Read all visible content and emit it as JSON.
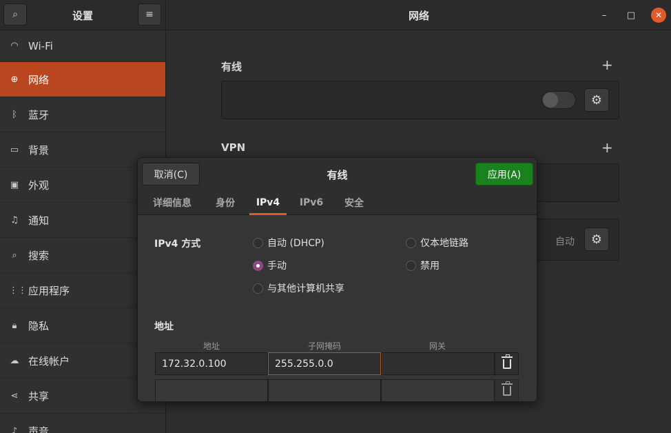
{
  "sidebar": {
    "title": "设置",
    "search_icon": "search-icon",
    "menu_icon": "menu-icon",
    "items": [
      {
        "label": "Wi-Fi",
        "icon": "wifi-icon",
        "glyph": "◠"
      },
      {
        "label": "网络",
        "icon": "network-icon",
        "glyph": "⊕"
      },
      {
        "label": "蓝牙",
        "icon": "bluetooth-icon",
        "glyph": "ᛒ"
      },
      {
        "label": "背景",
        "icon": "background-icon",
        "glyph": "▭"
      },
      {
        "label": "外观",
        "icon": "appearance-icon",
        "glyph": "▣"
      },
      {
        "label": "通知",
        "icon": "bell-icon",
        "glyph": "♫"
      },
      {
        "label": "搜索",
        "icon": "search-icon",
        "glyph": "⌕"
      },
      {
        "label": "应用程序",
        "icon": "apps-grid-icon",
        "glyph": "⋮⋮"
      },
      {
        "label": "隐私",
        "icon": "lock-icon",
        "glyph": "🔒"
      },
      {
        "label": "在线帐户",
        "icon": "cloud-icon",
        "glyph": "☁"
      },
      {
        "label": "共享",
        "icon": "share-icon",
        "glyph": "⋖"
      },
      {
        "label": "声音",
        "icon": "music-icon",
        "glyph": "♪"
      }
    ],
    "active_index": 1
  },
  "header": {
    "title": "网络"
  },
  "main": {
    "wired_label": "有线",
    "vpn_label": "VPN",
    "auto_text": "自动"
  },
  "dialog": {
    "title": "有线",
    "cancel_label": "取消(C)",
    "apply_label": "应用(A)",
    "tabs": [
      "详细信息",
      "身份",
      "IPv4",
      "IPv6",
      "安全"
    ],
    "active_tab": 2,
    "method_label": "IPv4 方式",
    "methods": [
      {
        "label": "自动 (DHCP)",
        "checked": false
      },
      {
        "label": "仅本地链路",
        "checked": false
      },
      {
        "label": "手动",
        "checked": true
      },
      {
        "label": "禁用",
        "checked": false
      },
      {
        "label": "与其他计算机共享",
        "checked": false
      }
    ],
    "address_section_label": "地址",
    "columns": {
      "address": "地址",
      "netmask": "子网掩码",
      "gateway": "网关"
    },
    "rows": [
      {
        "address": "172.32.0.100",
        "netmask": "255.255.0.0",
        "gateway": ""
      },
      {
        "address": "",
        "netmask": "",
        "gateway": ""
      }
    ]
  },
  "colors": {
    "accent": "#e3592a",
    "sidebar_active": "#b9461e",
    "apply_green": "#19811e",
    "radio_checked": "#8c4b80"
  }
}
